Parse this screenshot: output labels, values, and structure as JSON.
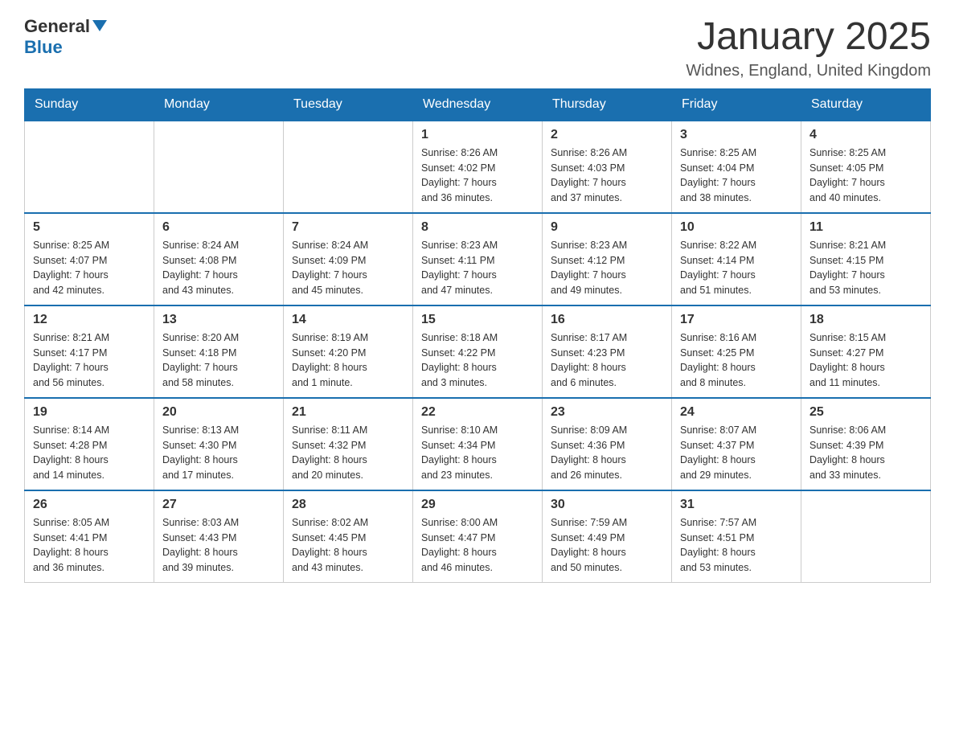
{
  "header": {
    "logo": {
      "general": "General",
      "blue": "Blue"
    },
    "title": "January 2025",
    "location": "Widnes, England, United Kingdom"
  },
  "calendar": {
    "weekdays": [
      "Sunday",
      "Monday",
      "Tuesday",
      "Wednesday",
      "Thursday",
      "Friday",
      "Saturday"
    ],
    "weeks": [
      [
        {
          "day": "",
          "info": ""
        },
        {
          "day": "",
          "info": ""
        },
        {
          "day": "",
          "info": ""
        },
        {
          "day": "1",
          "info": "Sunrise: 8:26 AM\nSunset: 4:02 PM\nDaylight: 7 hours\nand 36 minutes."
        },
        {
          "day": "2",
          "info": "Sunrise: 8:26 AM\nSunset: 4:03 PM\nDaylight: 7 hours\nand 37 minutes."
        },
        {
          "day": "3",
          "info": "Sunrise: 8:25 AM\nSunset: 4:04 PM\nDaylight: 7 hours\nand 38 minutes."
        },
        {
          "day": "4",
          "info": "Sunrise: 8:25 AM\nSunset: 4:05 PM\nDaylight: 7 hours\nand 40 minutes."
        }
      ],
      [
        {
          "day": "5",
          "info": "Sunrise: 8:25 AM\nSunset: 4:07 PM\nDaylight: 7 hours\nand 42 minutes."
        },
        {
          "day": "6",
          "info": "Sunrise: 8:24 AM\nSunset: 4:08 PM\nDaylight: 7 hours\nand 43 minutes."
        },
        {
          "day": "7",
          "info": "Sunrise: 8:24 AM\nSunset: 4:09 PM\nDaylight: 7 hours\nand 45 minutes."
        },
        {
          "day": "8",
          "info": "Sunrise: 8:23 AM\nSunset: 4:11 PM\nDaylight: 7 hours\nand 47 minutes."
        },
        {
          "day": "9",
          "info": "Sunrise: 8:23 AM\nSunset: 4:12 PM\nDaylight: 7 hours\nand 49 minutes."
        },
        {
          "day": "10",
          "info": "Sunrise: 8:22 AM\nSunset: 4:14 PM\nDaylight: 7 hours\nand 51 minutes."
        },
        {
          "day": "11",
          "info": "Sunrise: 8:21 AM\nSunset: 4:15 PM\nDaylight: 7 hours\nand 53 minutes."
        }
      ],
      [
        {
          "day": "12",
          "info": "Sunrise: 8:21 AM\nSunset: 4:17 PM\nDaylight: 7 hours\nand 56 minutes."
        },
        {
          "day": "13",
          "info": "Sunrise: 8:20 AM\nSunset: 4:18 PM\nDaylight: 7 hours\nand 58 minutes."
        },
        {
          "day": "14",
          "info": "Sunrise: 8:19 AM\nSunset: 4:20 PM\nDaylight: 8 hours\nand 1 minute."
        },
        {
          "day": "15",
          "info": "Sunrise: 8:18 AM\nSunset: 4:22 PM\nDaylight: 8 hours\nand 3 minutes."
        },
        {
          "day": "16",
          "info": "Sunrise: 8:17 AM\nSunset: 4:23 PM\nDaylight: 8 hours\nand 6 minutes."
        },
        {
          "day": "17",
          "info": "Sunrise: 8:16 AM\nSunset: 4:25 PM\nDaylight: 8 hours\nand 8 minutes."
        },
        {
          "day": "18",
          "info": "Sunrise: 8:15 AM\nSunset: 4:27 PM\nDaylight: 8 hours\nand 11 minutes."
        }
      ],
      [
        {
          "day": "19",
          "info": "Sunrise: 8:14 AM\nSunset: 4:28 PM\nDaylight: 8 hours\nand 14 minutes."
        },
        {
          "day": "20",
          "info": "Sunrise: 8:13 AM\nSunset: 4:30 PM\nDaylight: 8 hours\nand 17 minutes."
        },
        {
          "day": "21",
          "info": "Sunrise: 8:11 AM\nSunset: 4:32 PM\nDaylight: 8 hours\nand 20 minutes."
        },
        {
          "day": "22",
          "info": "Sunrise: 8:10 AM\nSunset: 4:34 PM\nDaylight: 8 hours\nand 23 minutes."
        },
        {
          "day": "23",
          "info": "Sunrise: 8:09 AM\nSunset: 4:36 PM\nDaylight: 8 hours\nand 26 minutes."
        },
        {
          "day": "24",
          "info": "Sunrise: 8:07 AM\nSunset: 4:37 PM\nDaylight: 8 hours\nand 29 minutes."
        },
        {
          "day": "25",
          "info": "Sunrise: 8:06 AM\nSunset: 4:39 PM\nDaylight: 8 hours\nand 33 minutes."
        }
      ],
      [
        {
          "day": "26",
          "info": "Sunrise: 8:05 AM\nSunset: 4:41 PM\nDaylight: 8 hours\nand 36 minutes."
        },
        {
          "day": "27",
          "info": "Sunrise: 8:03 AM\nSunset: 4:43 PM\nDaylight: 8 hours\nand 39 minutes."
        },
        {
          "day": "28",
          "info": "Sunrise: 8:02 AM\nSunset: 4:45 PM\nDaylight: 8 hours\nand 43 minutes."
        },
        {
          "day": "29",
          "info": "Sunrise: 8:00 AM\nSunset: 4:47 PM\nDaylight: 8 hours\nand 46 minutes."
        },
        {
          "day": "30",
          "info": "Sunrise: 7:59 AM\nSunset: 4:49 PM\nDaylight: 8 hours\nand 50 minutes."
        },
        {
          "day": "31",
          "info": "Sunrise: 7:57 AM\nSunset: 4:51 PM\nDaylight: 8 hours\nand 53 minutes."
        },
        {
          "day": "",
          "info": ""
        }
      ]
    ]
  }
}
